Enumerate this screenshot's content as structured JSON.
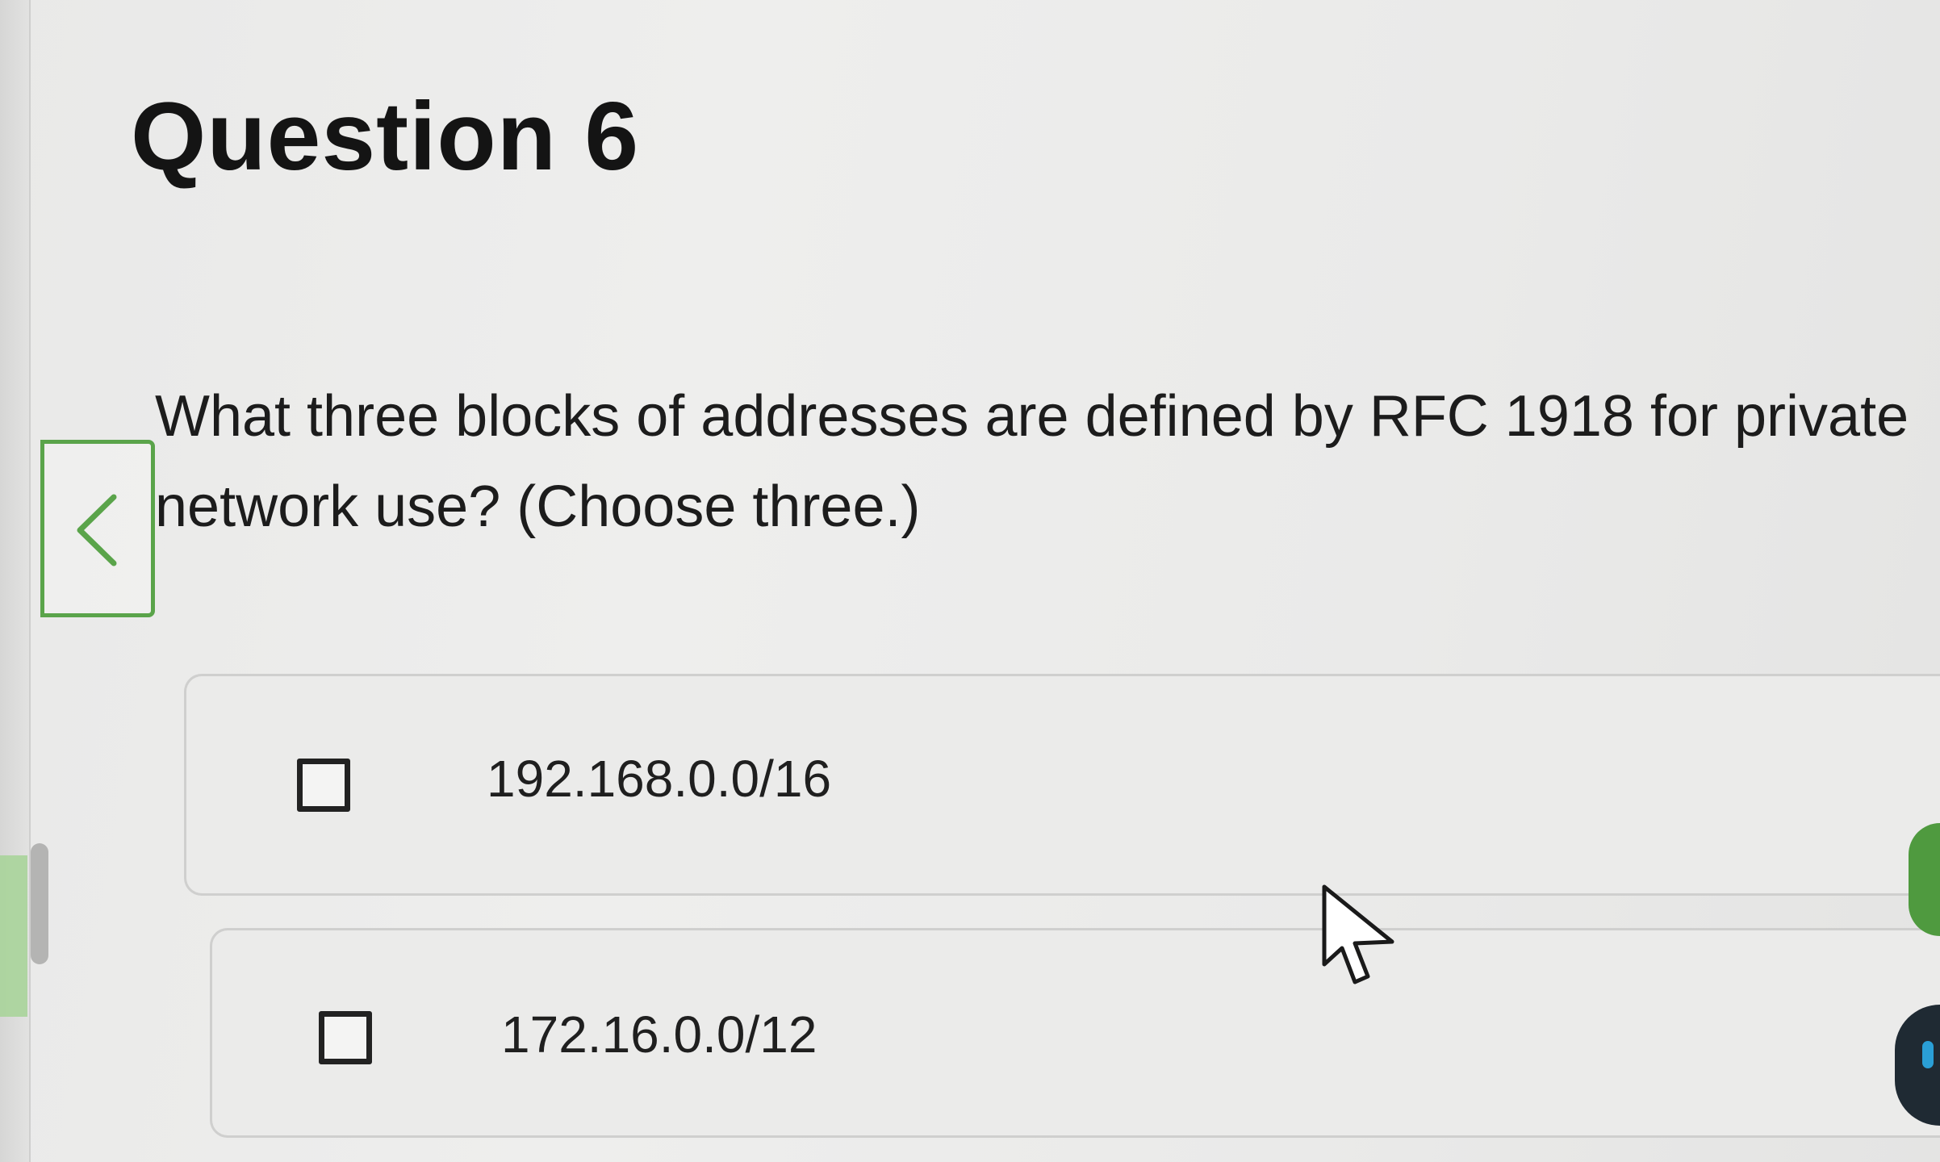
{
  "page": {
    "title": "Question 6"
  },
  "question": {
    "text": "What three blocks of addresses are defined by RFC 1918 for private network use? (Choose three.)"
  },
  "options": [
    {
      "label": "192.168.0.0/16",
      "checked": false
    },
    {
      "label": "172.16.0.0/12",
      "checked": false
    }
  ],
  "icons": {
    "back_tab": "chevron-left-icon",
    "pointer": "mouse-pointer-icon"
  },
  "colors": {
    "accent": "#5aa44a",
    "option_border": "#cfcfce",
    "text": "#1c1c1c"
  }
}
